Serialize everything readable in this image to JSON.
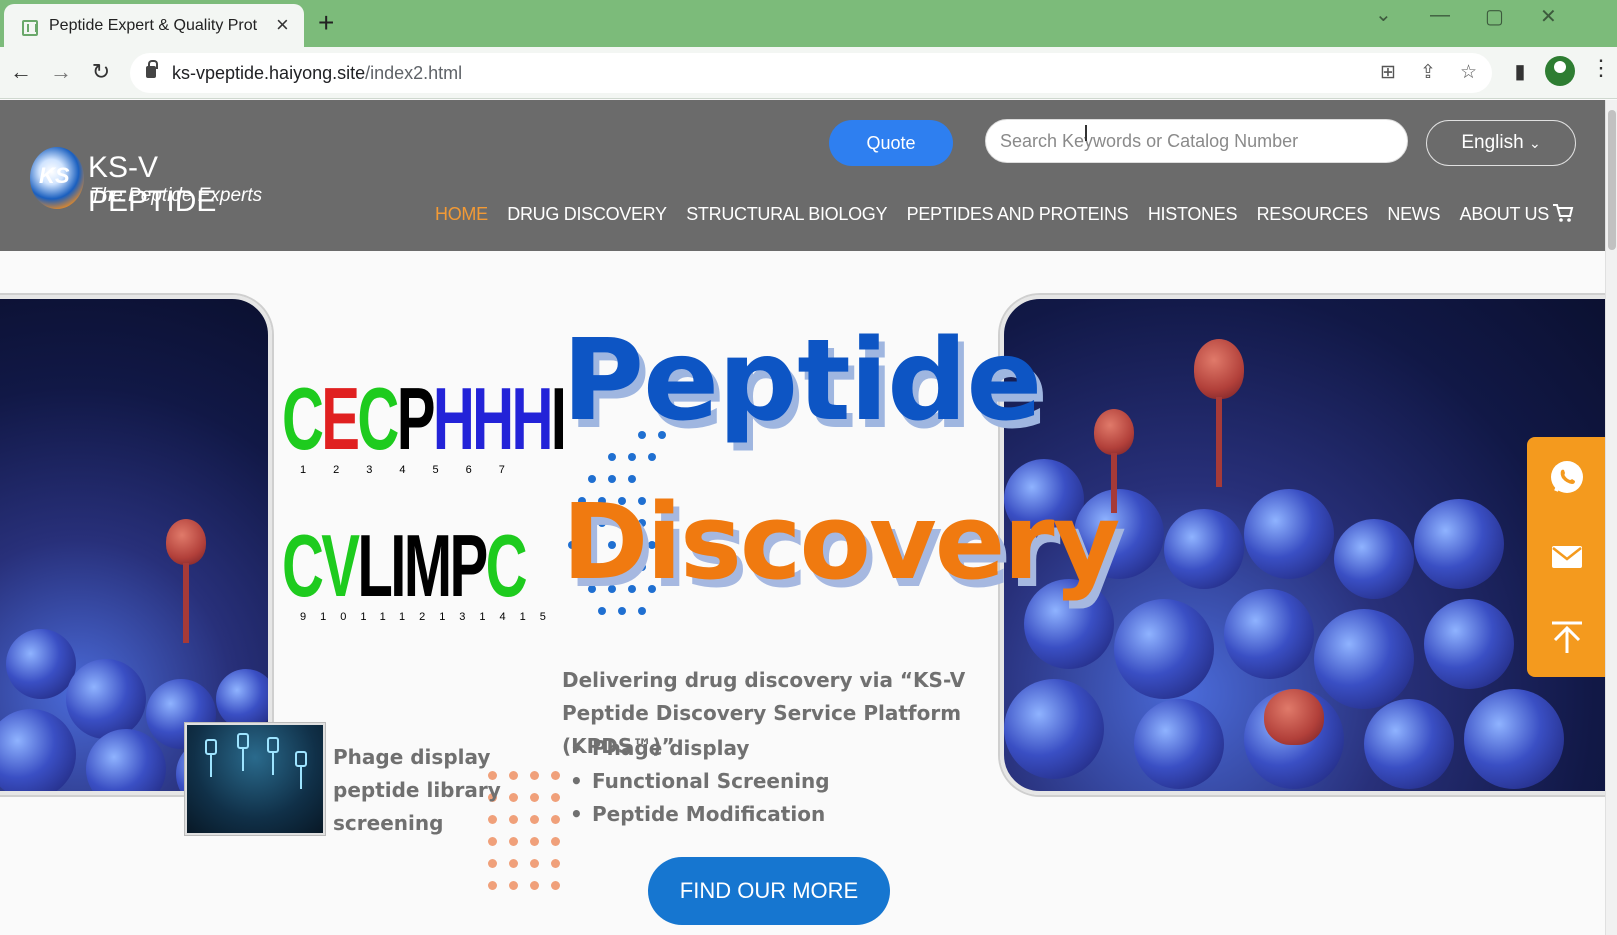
{
  "browser": {
    "tab_title": "Peptide Expert & Quality Prot",
    "url_host": "ks-vpeptide.haiyong.site",
    "url_path": "/index2.html"
  },
  "header": {
    "logo_name": "KS-V PEPTIDE",
    "logo_tagline": "The Peptide Experts",
    "quote_label": "Quote",
    "search_placeholder": "Search Keywords or Catalog Number",
    "language": "English",
    "nav": [
      "HOME",
      "DRUG DISCOVERY",
      "STRUCTURAL BIOLOGY",
      "PEPTIDES AND PROTEINS",
      "HISTONES",
      "RESOURCES",
      "NEWS",
      "ABOUT US"
    ],
    "active_nav": "HOME"
  },
  "hero": {
    "title_line1": "Peptide",
    "title_line2": "Discovery",
    "sequence_logo_1": "CECPHHHI",
    "sequence_logo_1_positions": "1234567",
    "sequence_logo_2": "CVLIMPC",
    "sequence_logo_2_positions": "9101112131415",
    "intro": "Delivering drug discovery via “KS-V Peptide Discovery Service Platform (KPDS™)”",
    "features": [
      "Phage display",
      "Functional Screening",
      "Peptide Modification"
    ],
    "thumbnail_caption": "Phage display peptide library screening",
    "cta_label": "FIND OUR MORE"
  },
  "colors": {
    "title_blue": "#0d55c4",
    "title_orange": "#f07a10",
    "nav_active": "#f39a35",
    "cta_blue": "#1676d0",
    "quote_blue": "#2e7ff0",
    "float_orange": "#f49a1e",
    "header_gray": "#6b6b6b",
    "tab_strip_green": "#7cbb7a"
  },
  "icons": {
    "float_bar": [
      "whatsapp-icon",
      "mail-icon",
      "back-to-top-icon"
    ],
    "cart": "cart-icon"
  }
}
